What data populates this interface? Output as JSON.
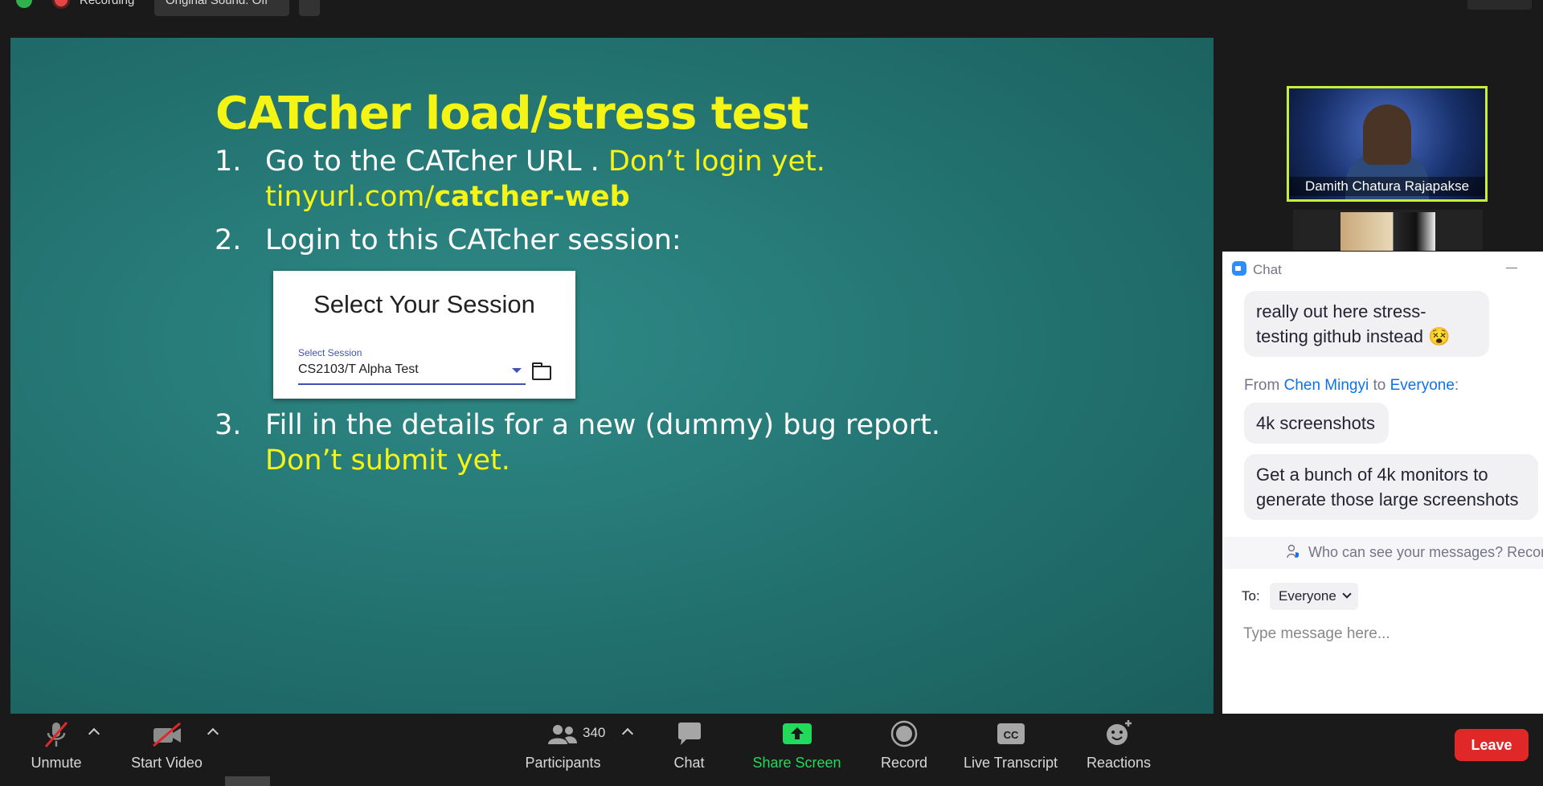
{
  "top_bar": {
    "recording_label": "Recording",
    "original_sound_label": "Original Sound: Off"
  },
  "slide": {
    "title": "CATcher load/stress test",
    "items": [
      {
        "number": "1.",
        "line1_white": "Go to the CATcher URL . ",
        "line1_yellow": "Don’t login yet.",
        "line2_normal": "tinyurl.com/",
        "line2_bold": "catcher-web"
      },
      {
        "number": "2.",
        "text": "Login to this CATcher session:"
      },
      {
        "number": "3.",
        "line1": "Fill in the details for a new (dummy) bug report.",
        "line2": "Don’t submit yet."
      }
    ],
    "session_card": {
      "title": "Select Your Session",
      "field_label": "Select Session",
      "field_value": "CS2103/T Alpha Test"
    }
  },
  "video": {
    "speaker_name": "Damith Chatura Rajapakse"
  },
  "chat": {
    "title": "Chat",
    "messages": [
      {
        "text": "really out here stress-testing github instead 😵"
      },
      {
        "text": "4k screenshots"
      },
      {
        "text": "Get a bunch of 4k monitors to generate those large screenshots"
      }
    ],
    "from_prefix": "From ",
    "from_sender": "Chen Mingyi",
    "from_mid": " to ",
    "from_recipient": "Everyone",
    "from_suffix": ":",
    "privacy_text": "Who can see your messages? Recording",
    "to_label": "To:",
    "to_value": "Everyone",
    "input_placeholder": "Type message here..."
  },
  "toolbar": {
    "unmute": "Unmute",
    "start_video": "Start Video",
    "participants": "Participants",
    "participants_count": "340",
    "chat": "Chat",
    "share_screen": "Share Screen",
    "record": "Record",
    "live_transcript": "Live Transcript",
    "reactions": "Reactions",
    "leave": "Leave"
  },
  "colors": {
    "share_green": "#23d959",
    "leave_red": "#e02828",
    "speaker_border": "#c6ef3a",
    "slide_yellow": "#f5f515"
  }
}
